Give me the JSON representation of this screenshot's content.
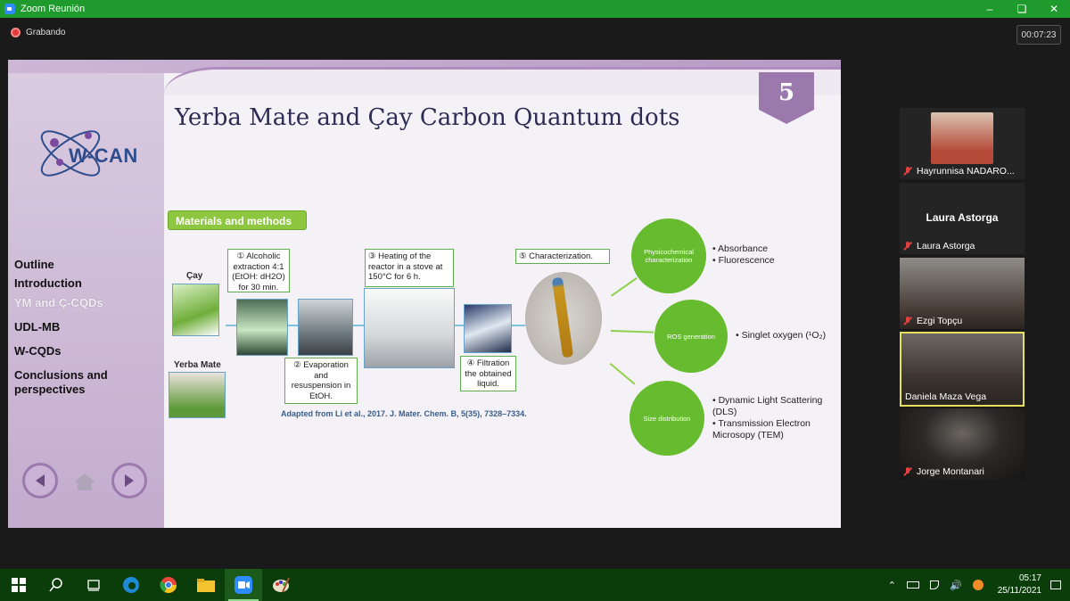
{
  "window": {
    "title": "Zoom Reunión",
    "recording_label": "Grabando",
    "timer": "00:07:23"
  },
  "slide": {
    "title": "Yerba Mate and Çay Carbon Quantum dots",
    "slide_number": "5",
    "logo_text": "W-CAN",
    "outline": [
      "Outline",
      "Introduction",
      "YM and Ç-CQDs",
      "UDL-MB",
      "W-CQDs",
      "Conclusions and perspectives"
    ],
    "materials_label": "Materials and methods",
    "cay_label": "Çay",
    "yerba_label": "Yerba Mate",
    "step1": "① Alcoholic extraction 4:1 (EtOH: dH2O) for 30 min.",
    "step2": "② Evaporation and resuspension in EtOH.",
    "step3": "③ Heating of the reactor in a stove at 150°C for 6 h.",
    "step4": "④ Filtration the obtained liquid.",
    "step5": "⑤ Characterization.",
    "citation": "Adapted from Li et al., 2017. J. Mater. Chem. B, 5(35), 7328–7334.",
    "circles": {
      "physico": "Physicochemical characterization",
      "ros": "ROS generation",
      "size": "Size distribution"
    },
    "physico_bullets": [
      "Absorbance",
      "Fluorescence"
    ],
    "ros_bullets": [
      "Singlet oxygen (¹O₂)"
    ],
    "size_bullets": [
      "Dynamic Light Scattering (DLS)",
      "Transmission Electron Microsopy (TEM)"
    ]
  },
  "participants": [
    {
      "name": "Hayrunnisa NADARO...",
      "muted": true
    },
    {
      "name": "Laura Astorga",
      "display": "Laura Astorga",
      "muted": true
    },
    {
      "name": "Ezgi Topçu",
      "muted": true
    },
    {
      "name": "Daniela Maza Vega",
      "muted": false,
      "active": true
    },
    {
      "name": "Jorge Montanari",
      "muted": true
    }
  ],
  "taskbar": {
    "time": "05:17",
    "date": "25/11/2021",
    "apps": [
      "windows-start",
      "search",
      "task-view",
      "edge",
      "chrome",
      "file-explorer",
      "zoom",
      "paint"
    ]
  },
  "colors": {
    "titlebar": "#1f9a2c",
    "taskbar": "#0b3d0b",
    "accent_green": "#66bb2e",
    "slide_purple": "#9b79ad"
  }
}
